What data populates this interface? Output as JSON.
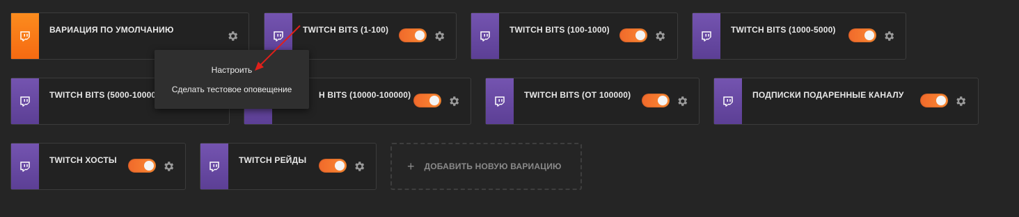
{
  "variations": [
    {
      "title": "ВАРИАЦИЯ ПО УМОЛЧАНИЮ",
      "color": "orange",
      "toggle": false
    },
    {
      "title": "TWITCH BITS (1-100)",
      "color": "purple",
      "toggle": true
    },
    {
      "title": "TWITCH BITS (100-1000)",
      "color": "purple",
      "toggle": true
    },
    {
      "title": "TWITCH BITS (1000-5000)",
      "color": "purple",
      "toggle": true
    },
    {
      "title": "TWITCH BITS (5000-10000",
      "color": "purple",
      "toggle": true
    },
    {
      "title": "H BITS (10000-100000)",
      "color": "purple",
      "toggle": true
    },
    {
      "title": "TWITCH BITS (ОТ 100000)",
      "color": "purple",
      "toggle": true
    },
    {
      "title": "ПОДПИСКИ ПОДАРЕННЫЕ КАНАЛУ",
      "color": "purple",
      "toggle": true
    },
    {
      "title": "TWITCH ХОСТЫ",
      "color": "purple",
      "toggle": true
    },
    {
      "title": "TWITCH РЕЙДЫ",
      "color": "purple",
      "toggle": true
    }
  ],
  "add_variation": {
    "icon": "plus-icon",
    "label": "ДОБАВИТЬ НОВУЮ ВАРИАЦИЮ"
  },
  "context_menu": {
    "items": [
      "Настроить",
      "Сделать тестовое оповещение"
    ]
  },
  "colors": {
    "background": "#252525",
    "card": "#222222",
    "purple": "#6a4aa5",
    "orange": "#f87a18",
    "toggle": "#f47b30",
    "arrow": "#e0201a"
  },
  "icons": {
    "side": "twitch-glitch-icon",
    "settings": "gear-icon",
    "annotation": "red-arrow"
  }
}
